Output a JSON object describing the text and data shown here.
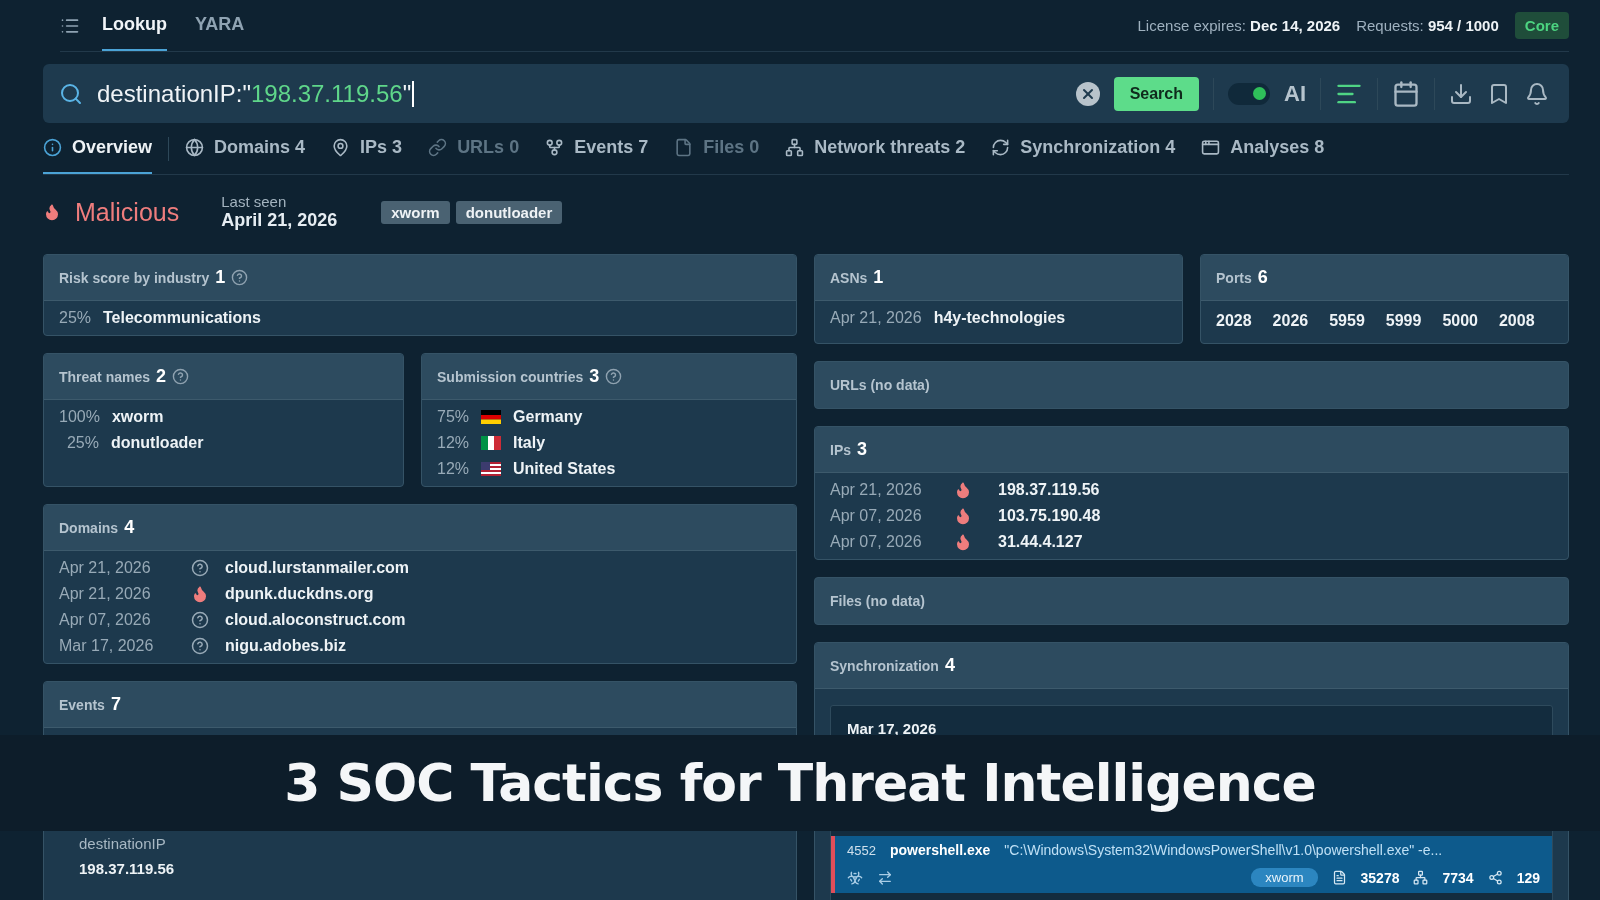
{
  "topbar": {
    "nav": [
      {
        "label": "Lookup",
        "selected": true
      },
      {
        "label": "YARA",
        "selected": false
      }
    ],
    "license_label": "License expires:",
    "license_value": "Dec 14, 2026",
    "requests_label": "Requests:",
    "requests_value": "954 / 1000",
    "plan": "Core"
  },
  "search": {
    "prefix": "destinationIP:\"",
    "highlight": "198.37.119.56",
    "suffix": "\"",
    "button": "Search",
    "ai_label": "AI",
    "ai_on": true
  },
  "tabs": [
    {
      "label": "Overview",
      "selected": true,
      "disabled": false
    },
    {
      "label": "Domains 4",
      "selected": false,
      "disabled": false
    },
    {
      "label": "IPs 3",
      "selected": false,
      "disabled": false
    },
    {
      "label": "URLs 0",
      "selected": false,
      "disabled": true
    },
    {
      "label": "Events 7",
      "selected": false,
      "disabled": false
    },
    {
      "label": "Files 0",
      "selected": false,
      "disabled": true
    },
    {
      "label": "Network threats 2",
      "selected": false,
      "disabled": false
    },
    {
      "label": "Synchronization 4",
      "selected": false,
      "disabled": false
    },
    {
      "label": "Analyses 8",
      "selected": false,
      "disabled": false
    }
  ],
  "summary": {
    "verdict": "Malicious",
    "last_seen_label": "Last seen",
    "last_seen": "April 21, 2026",
    "tags": [
      "xworm",
      "donutloader"
    ]
  },
  "risk": {
    "title": "Risk score by industry",
    "count": "1",
    "rows": [
      {
        "share": "25%",
        "name": "Telecommunications"
      }
    ]
  },
  "threat_names": {
    "title": "Threat names",
    "count": "2",
    "rows": [
      {
        "share": "100%",
        "name": "xworm"
      },
      {
        "share": "25%",
        "name": "donutloader"
      }
    ]
  },
  "countries": {
    "title": "Submission countries",
    "count": "3",
    "rows": [
      {
        "share": "75%",
        "kind": "de",
        "name": "Germany"
      },
      {
        "share": "12%",
        "kind": "it",
        "name": "Italy"
      },
      {
        "share": "12%",
        "kind": "us",
        "name": "United States"
      }
    ]
  },
  "domains": {
    "title": "Domains",
    "count": "4",
    "rows": [
      {
        "date": "Apr 21, 2026",
        "malicious": false,
        "name": "cloud.lurstanmailer.com"
      },
      {
        "date": "Apr 21, 2026",
        "malicious": true,
        "name": "dpunk.duckdns.org"
      },
      {
        "date": "Apr 07, 2026",
        "malicious": false,
        "name": "cloud.aloconstruct.com"
      },
      {
        "date": "Mar 17, 2026",
        "malicious": false,
        "name": "nigu.adobes.biz"
      }
    ]
  },
  "events": {
    "title": "Events",
    "count": "7",
    "field_label": "destinationIP",
    "field_value": "198.37.119.56"
  },
  "asns": {
    "title": "ASNs",
    "count": "1",
    "rows": [
      {
        "date": "Apr 21, 2026",
        "name": "h4y-technologies"
      }
    ]
  },
  "ports": {
    "title": "Ports",
    "count": "6",
    "values": [
      "2028",
      "2026",
      "5959",
      "5999",
      "5000",
      "2008"
    ]
  },
  "urls": {
    "title": "URLs (no data)"
  },
  "ips": {
    "title": "IPs",
    "count": "3",
    "rows": [
      {
        "date": "Apr 21, 2026",
        "malicious": true,
        "name": "198.37.119.56"
      },
      {
        "date": "Apr 07, 2026",
        "malicious": true,
        "name": "103.75.190.48"
      },
      {
        "date": "Apr 07, 2026",
        "malicious": true,
        "name": "31.44.4.127"
      }
    ]
  },
  "files": {
    "title": "Files (no data)"
  },
  "sync": {
    "title": "Synchronization",
    "count": "4",
    "date": "Mar 17, 2026",
    "process": {
      "pid": "4552",
      "name": "powershell.exe",
      "command": "\"C:\\Windows\\System32\\WindowsPowerShell\\v1.0\\powershell.exe\" -e...",
      "tag": "xworm",
      "files": "35278",
      "modules": "7734",
      "connections": "129"
    }
  },
  "banner": {
    "title": "3 SOC Tactics for Threat Intelligence"
  }
}
